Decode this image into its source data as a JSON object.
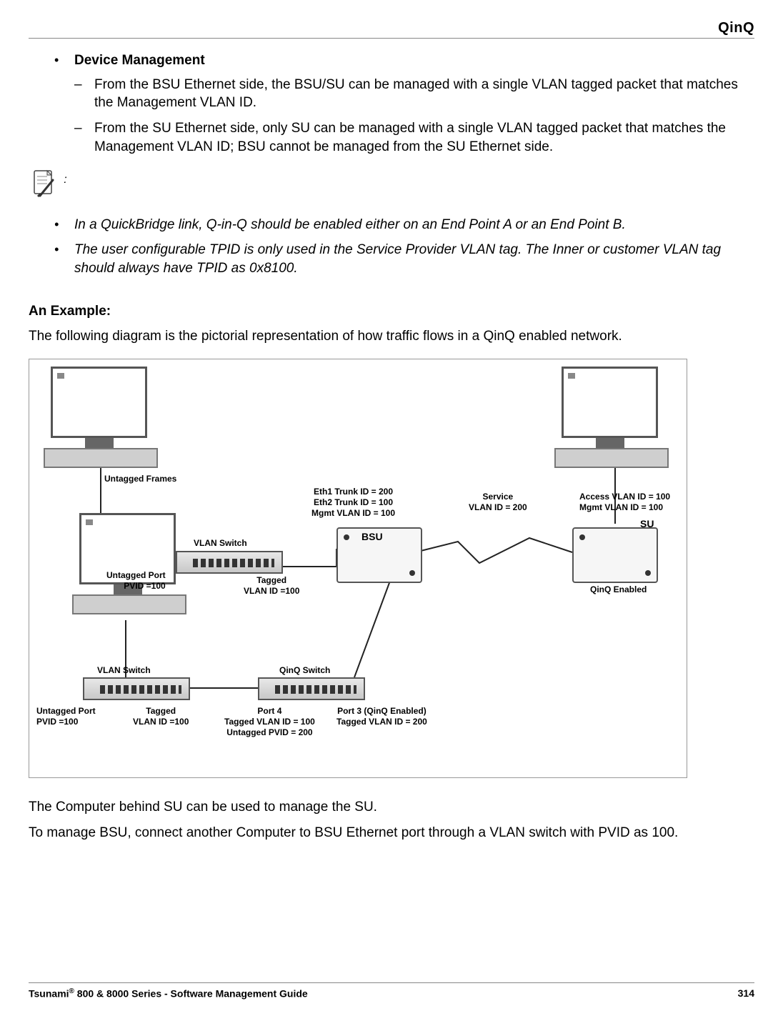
{
  "header": {
    "title": "QinQ"
  },
  "sections": {
    "device_management": {
      "title": "Device Management",
      "sub": [
        "From the BSU Ethernet side, the BSU/SU can be managed with a single VLAN tagged packet that matches the Management VLAN ID.",
        "From the SU Ethernet side, only SU can be managed with a single VLAN tagged packet that matches the Management VLAN ID; BSU cannot be managed from the SU Ethernet side."
      ]
    },
    "note_colon": ":",
    "notes": [
      "In a QuickBridge link, Q-in-Q should be enabled either on an End Point A or an End Point B.",
      "The user configurable TPID is only used in the Service Provider VLAN tag. The Inner or customer VLAN tag should always have TPID as 0x8100."
    ],
    "example_heading": "An Example:",
    "example_intro": "The following diagram is the pictorial representation of how traffic flows in a QinQ enabled network.",
    "after_diagram_1": "The Computer behind SU can be used to manage the SU.",
    "after_diagram_2": "To manage BSU, connect another Computer to BSU Ethernet port through a VLAN switch with PVID as 100."
  },
  "diagram": {
    "untagged_frames": "Untagged Frames",
    "vlan_switch_top": "VLAN Switch",
    "untagged_port_pvid_100_top": "Untagged Port\nPVID =100",
    "tagged_vlan_id_100_top": "Tagged\nVLAN ID =100",
    "bsu_config": "Eth1 Trunk ID = 200\nEth2 Trunk ID = 100\nMgmt VLAN ID = 100",
    "bsu": "BSU",
    "service_vlan": "Service\nVLAN ID = 200",
    "su": "SU",
    "su_config": "Access VLAN ID = 100\nMgmt VLAN ID = 100",
    "qinq_enabled_su": "QinQ Enabled",
    "vlan_switch_bottom": "VLAN Switch",
    "untagged_port_pvid_100_bottom": "Untagged Port\nPVID =100",
    "tagged_vlan_id_100_bottom": "Tagged\nVLAN ID =100",
    "qinq_switch": "QinQ Switch",
    "port4": "Port 4\nTagged VLAN ID = 100\nUntagged PVID = 200",
    "port3": "Port 3 (QinQ Enabled)\nTagged VLAN ID = 200"
  },
  "footer": {
    "left_pre": "Tsunami",
    "left_sup": "®",
    "left_post": " 800 & 8000 Series - Software Management Guide",
    "page": "314"
  }
}
